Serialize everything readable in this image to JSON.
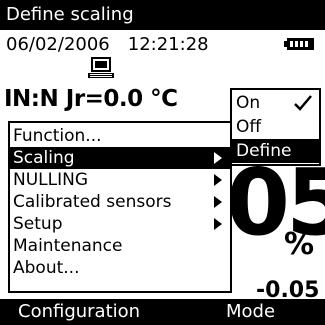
{
  "header": {
    "title": "Define scaling",
    "date": "06/02/2006",
    "time": "12:21:28",
    "icons": [
      "battery-icon",
      "computer-icon"
    ]
  },
  "measurement": {
    "label": "IN:N Jr=0.0 °C",
    "big_value": "05",
    "unit": "%",
    "secondary_value": "-0.05"
  },
  "main_menu": {
    "items": [
      {
        "label": "Function...",
        "has_submenu": false,
        "selected": false
      },
      {
        "label": "Scaling",
        "has_submenu": true,
        "selected": true
      },
      {
        "label": "NULLING",
        "has_submenu": true,
        "selected": false
      },
      {
        "label": "Calibrated sensors",
        "has_submenu": true,
        "selected": false
      },
      {
        "label": "Setup",
        "has_submenu": true,
        "selected": false
      },
      {
        "label": "Maintenance",
        "has_submenu": false,
        "selected": false
      },
      {
        "label": "About...",
        "has_submenu": false,
        "selected": false
      }
    ]
  },
  "sub_menu": {
    "items": [
      {
        "label": "On",
        "checked": true,
        "selected": false
      },
      {
        "label": "Off",
        "checked": false,
        "selected": false
      },
      {
        "label": "Define",
        "has_submenu": true,
        "selected": true
      }
    ]
  },
  "softkeys": {
    "left": "Configuration",
    "right": "Mode"
  },
  "colors": {
    "background": "#ffffff",
    "foreground": "#000000",
    "highlight": "#000000",
    "highlight_text": "#ffffff"
  }
}
